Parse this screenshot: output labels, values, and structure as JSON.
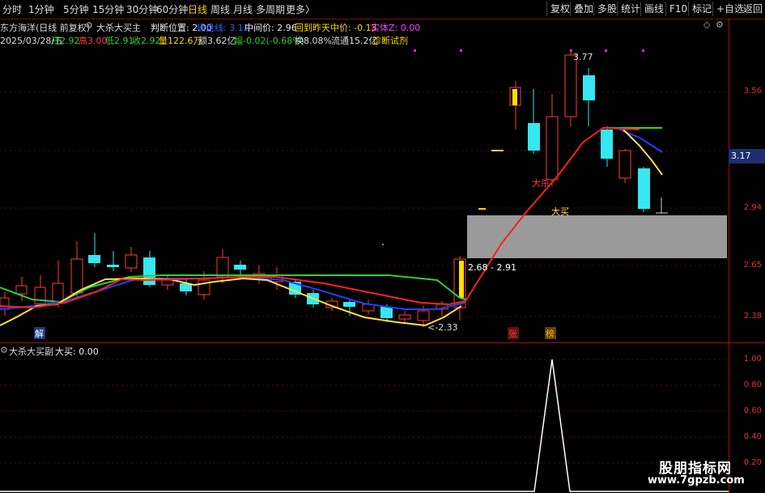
{
  "toolbar": {
    "periods": [
      "分时",
      "1分钟",
      "5分钟",
      "15分钟",
      "30分钟",
      "60分钟",
      "日线",
      "周线",
      "月线",
      "多周期",
      "更多"
    ],
    "active_period": "日线",
    "more_arrow": "〉",
    "right_buttons": [
      "复权",
      "叠加",
      "多股",
      "统计",
      "画线",
      "F10",
      "标记",
      "+自选",
      "返回"
    ]
  },
  "header": {
    "stock_title": "东方海洋(日线 前复权)",
    "indicator_name": "大杀大买主",
    "judge_label": "判断位置: 2.00",
    "jiyun_label": "操盘线: 3.12",
    "mid_label": "中间价: 2.96",
    "back_label": "回到昨天中价: -0.13",
    "body_label": "实体Z: 0.00",
    "date": "2025/03/28/五",
    "open_label": "开2.92",
    "high_label": "高3.00",
    "low_label": "低2.91",
    "close_label": "收2.92",
    "vol_label": "量122.6万",
    "amount_label": "额3.62亿",
    "change_label": "幅-0.02(-0.68%)",
    "turnover_label": "换8.08%",
    "float_label": "流通15.2亿",
    "diag_label": "诊断试剂"
  },
  "sub_header": {
    "indicator_name": "大杀大买副",
    "value_label": "大买: 0.00"
  },
  "axis_main": [
    "3.56",
    "3.17",
    "2.94",
    "2.65",
    "2.38"
  ],
  "axis_sub": [
    "1.00",
    "0.80",
    "0.60",
    "0.40",
    "0.20"
  ],
  "current_price_tag": "3.17",
  "annotations": {
    "high_mark": "3.77",
    "low_mark": "2.33",
    "range_mark": "2.68 - 2.91",
    "dasha_label": "大杀",
    "damai_label": "大买",
    "jie_badge": "解",
    "zhang_badge": "张",
    "bang_badge": "榜"
  },
  "colors": {
    "up": "#ff3b3b",
    "down": "#36e6f0",
    "ma_red": "#ff2020",
    "ma_green": "#30d030",
    "ma_blue": "#2040ff",
    "ma_yellow": "#ffe040"
  },
  "watermark": {
    "line1": "股朋指标网",
    "line2": "www.7gpzb.com"
  }
}
